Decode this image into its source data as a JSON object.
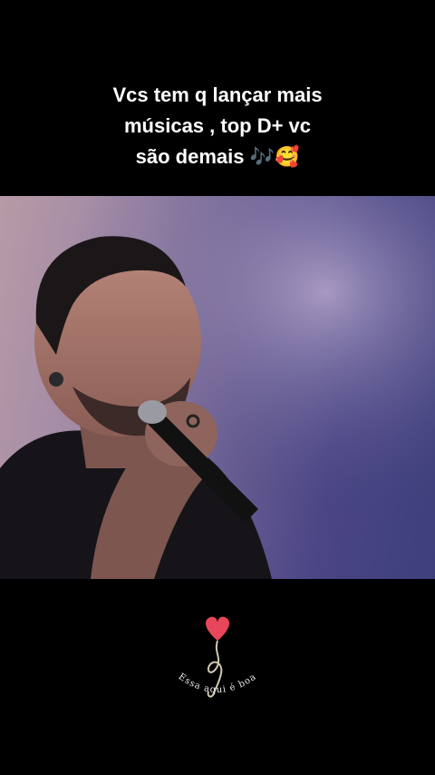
{
  "caption": {
    "line1": "Vcs tem q lançar mais",
    "line2": "músicas , top D+ vc",
    "line3": "são demais 🎶🥰"
  },
  "logo": {
    "text": "Essa aqui é boa",
    "heart_color": "#e8465a",
    "note_color": "#cfc8b0"
  },
  "colors": {
    "background": "#000000",
    "caption_text": "#ffffff"
  }
}
